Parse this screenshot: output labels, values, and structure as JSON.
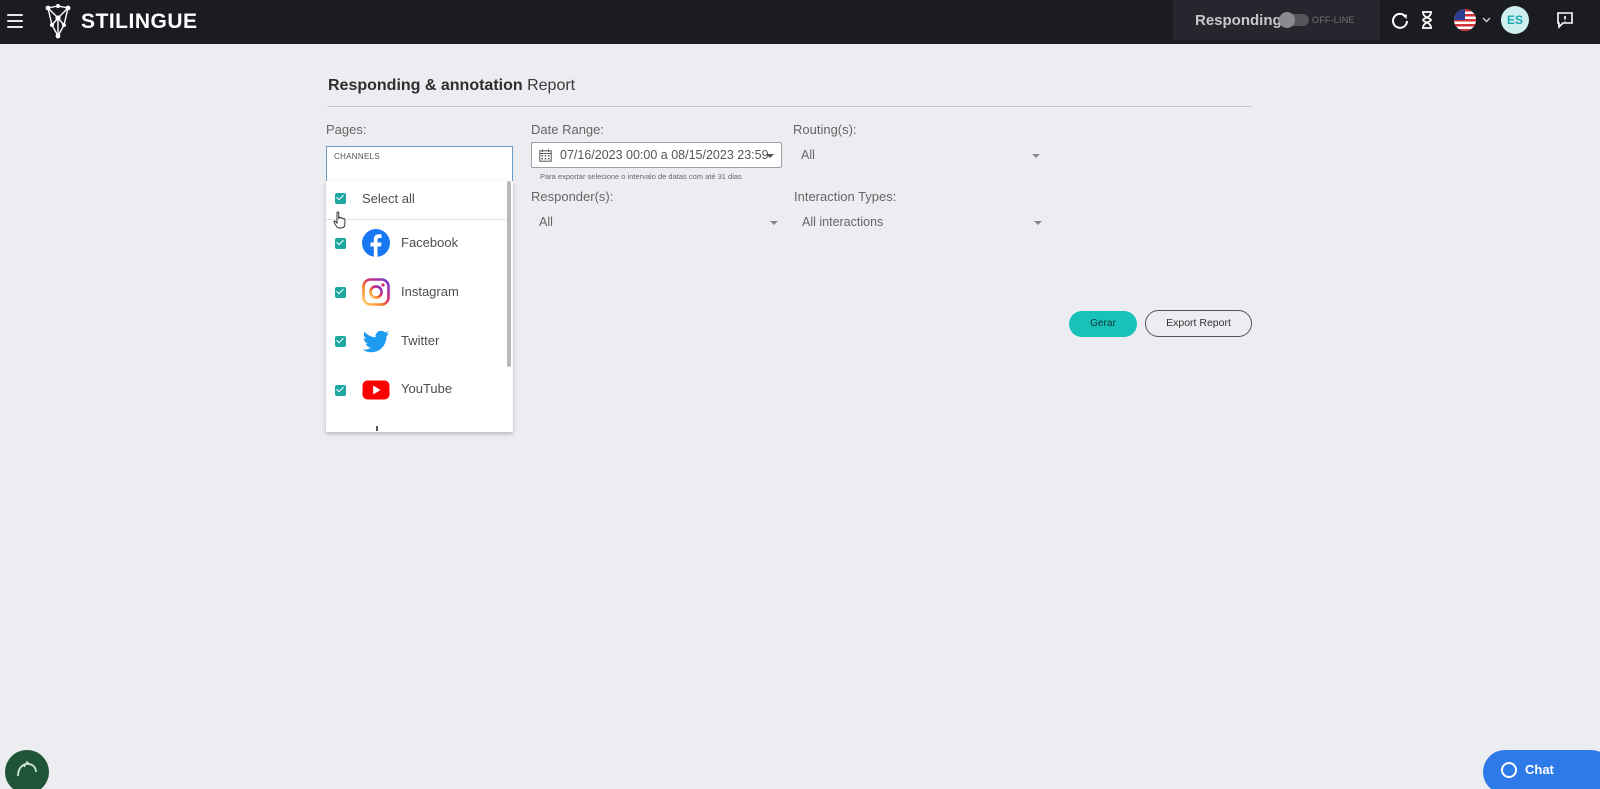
{
  "app": {
    "brand": "STILINGUE"
  },
  "topbar": {
    "responding_label": "Responding",
    "status_text": "OFF-LINE",
    "avatar_initials": "ES"
  },
  "page": {
    "title_bold": "Responding & annotation",
    "title_rest": " Report"
  },
  "pages": {
    "label": "Pages:",
    "input_placeholder": "CHANNELS",
    "select_all": "Select all",
    "options": [
      {
        "label": "Facebook",
        "checked": true,
        "icon": "facebook-icon"
      },
      {
        "label": "Instagram",
        "checked": true,
        "icon": "instagram-icon"
      },
      {
        "label": "Twitter",
        "checked": true,
        "icon": "twitter-icon"
      },
      {
        "label": "YouTube",
        "checked": true,
        "icon": "youtube-icon"
      }
    ]
  },
  "date_range": {
    "label": "Date Range:",
    "value": "07/16/2023 00:00 a 08/15/2023 23:59",
    "hint": "Para exportar selecione o intervalo de datas com até 31 dias"
  },
  "routing": {
    "label": "Routing(s):",
    "value": "All"
  },
  "responders": {
    "label": "Responder(s):",
    "value": "All"
  },
  "interaction_types": {
    "label": "Interaction Types:",
    "value": "All interactions"
  },
  "actions": {
    "generate": "Gerar",
    "export": "Export Report"
  },
  "chat": {
    "label": "Chat"
  },
  "colors": {
    "accent": "#18c2b8",
    "checkbox": "#1fa7a2",
    "topbar": "#1b1c22",
    "chat": "#2d7ae8"
  }
}
